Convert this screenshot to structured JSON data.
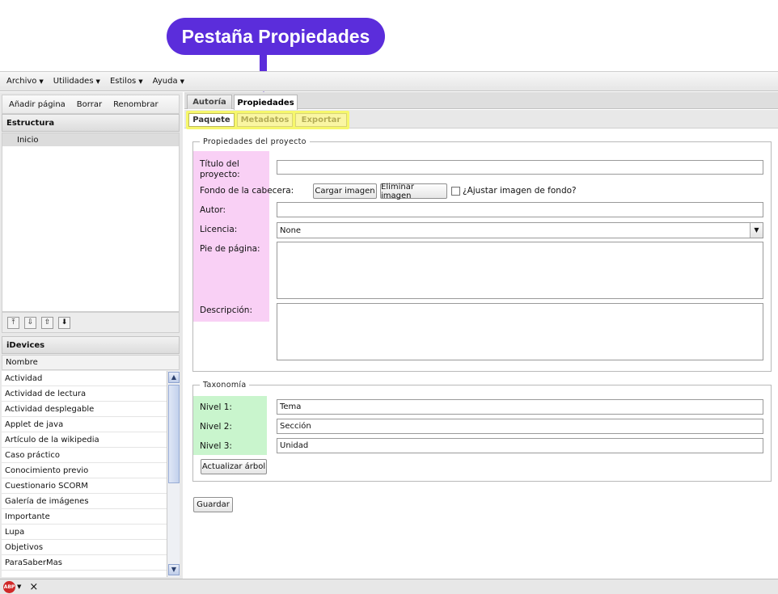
{
  "callout": {
    "text": "Pestaña Propiedades"
  },
  "menu": [
    "Archivo",
    "Utilidades",
    "Estilos",
    "Ayuda"
  ],
  "left": {
    "toolbar": [
      "Añadir página",
      "Borrar",
      "Renombrar"
    ],
    "structure_title": "Estructura",
    "tree_items": [
      "Inicio"
    ],
    "idevices_title": "iDevices",
    "column_header": "Nombre",
    "idevices": [
      "Actividad",
      "Actividad de lectura",
      "Actividad desplegable",
      "Applet de java",
      "Artículo de la wikipedia",
      "Caso práctico",
      "Conocimiento previo",
      "Cuestionario SCORM",
      "Galería de imágenes",
      "Importante",
      "Lupa",
      "Objetivos",
      "ParaSaberMas"
    ]
  },
  "tabs": [
    "Autoría",
    "Propiedades"
  ],
  "active_tab": "Propiedades",
  "subtabs": [
    "Paquete",
    "Metadatos",
    "Exportar"
  ],
  "active_subtab": "Paquete",
  "project": {
    "legend": "Propiedades del proyecto",
    "title_label_1": "Título del",
    "title_label_2": "proyecto:",
    "title_value": "",
    "header_bg_label": "Fondo de la cabecera:",
    "load_image": "Cargar imagen",
    "remove_image": "Eliminar imagen",
    "adjust_label": "¿Ajustar imagen de fondo?",
    "adjust_checked": false,
    "author_label": "Autor:",
    "author_value": "",
    "license_label": "Licencia:",
    "license_value": "None",
    "footer_label": "Pie de página:",
    "footer_value": "",
    "description_label": "Descripción:",
    "description_value": ""
  },
  "taxonomy": {
    "legend": "Taxonomía",
    "levels": [
      {
        "label": "Nivel 1:",
        "value": "Tema"
      },
      {
        "label": "Nivel 2:",
        "value": "Sección"
      },
      {
        "label": "Nivel 3:",
        "value": "Unidad"
      }
    ],
    "update_button": "Actualizar árbol"
  },
  "save_button": "Guardar",
  "statusbar": {
    "abp": "ABP",
    "close": "×"
  },
  "colors": {
    "callout": "#5b2ddb",
    "subtab_highlight": "#f6f76c",
    "labels_highlight": "#f9d0f5",
    "levels_highlight": "#c9f5cd"
  },
  "icons": {
    "move_buttons": [
      "move-top-icon",
      "move-down-icon",
      "move-up-icon",
      "move-bottom-icon"
    ]
  }
}
